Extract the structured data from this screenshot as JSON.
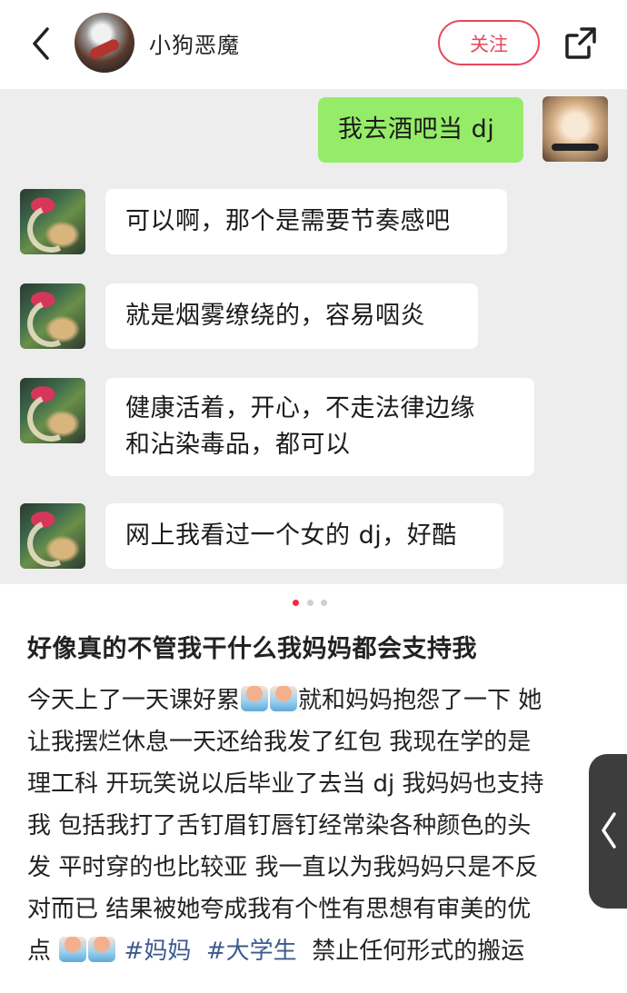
{
  "header": {
    "username": "小狗恶魔",
    "follow_label": "关注",
    "back_icon": "chevron-left-icon",
    "share_icon": "share-icon"
  },
  "chat": {
    "messages": [
      {
        "side": "right",
        "text": "我去酒吧当 dj"
      },
      {
        "side": "left",
        "text": "可以啊，那个是需要节奏感吧"
      },
      {
        "side": "left",
        "text": "就是烟雾缭绕的，容易咽炎"
      },
      {
        "side": "left",
        "lines": [
          "健康活着，开心，不走法律边缘",
          "和沾染毒品，都可以"
        ]
      },
      {
        "side": "left",
        "text": "网上我看过一个女的 dj，好酷"
      }
    ]
  },
  "carousel": {
    "count": 3,
    "active": 0,
    "active_color": "#ff2442"
  },
  "post": {
    "title": "好像真的不管我干什么我妈妈都会支持我",
    "line1_a": "今天上了一天课好累",
    "line1_b": "就和妈妈抱怨了一下 她",
    "line2": "让我摆烂休息一天还给我发了红包 我现在学的是",
    "line3": "理工科 开玩笑说以后毕业了去当 dj 我妈妈也支持",
    "line4": "我 包括我打了舌钉眉钉唇钉经常染各种颜色的头",
    "line5": "发 平时穿的也比较亚 我一直以为我妈妈只是不反",
    "line6": "对而已 结果被她夸成我有个性有思想有审美的优",
    "line7_a": "点",
    "tag1": "#妈妈",
    "tag2": "#大学生",
    "line7_b": "禁止任何形式的搬运",
    "tag_color": "#3c5a8c"
  },
  "colors": {
    "accent": "#e8475a",
    "chat_bg": "#ededed",
    "my_bubble": "#95ec69"
  }
}
